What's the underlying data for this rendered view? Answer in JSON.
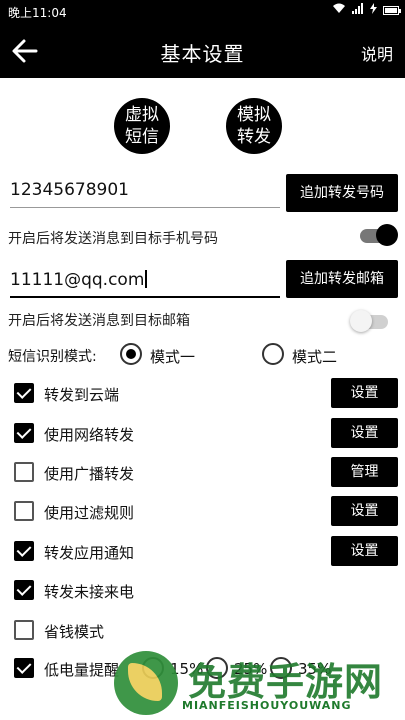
{
  "status_bar": {
    "time": "晚上11:04",
    "wifi_icon": "wifi-icon",
    "signal_icon": "signal-icon",
    "bolt_icon": "charging-icon",
    "battery_level": 0.85
  },
  "app_bar": {
    "back_icon": "arrow-left-icon",
    "title": "基本设置",
    "help": "说明"
  },
  "circle_buttons": {
    "virtual_sms": [
      "虚拟",
      "短信"
    ],
    "simulate_forward": [
      "模拟",
      "转发"
    ]
  },
  "phone": {
    "value": "12345678901",
    "add_button": "追加转发号码",
    "description": "开启后将发送消息到目标手机号码",
    "toggle_on": true
  },
  "email": {
    "value": "11111@qq.com",
    "add_button": "追加转发邮箱",
    "description": "开启后将发送消息到目标邮箱",
    "toggle_on": false
  },
  "sms_mode": {
    "label": "短信识别模式:",
    "option1": "模式一",
    "option2": "模式二",
    "selected": "模式一"
  },
  "options": [
    {
      "label": "转发到云端",
      "checked": true,
      "button": "设置"
    },
    {
      "label": "使用网络转发",
      "checked": true,
      "button": "设置"
    },
    {
      "label": "使用广播转发",
      "checked": false,
      "button": "管理"
    },
    {
      "label": "使用过滤规则",
      "checked": false,
      "button": "设置"
    },
    {
      "label": "转发应用通知",
      "checked": true,
      "button": "设置"
    },
    {
      "label": "转发未接来电",
      "checked": true,
      "button": ""
    },
    {
      "label": "省钱模式",
      "checked": false,
      "button": ""
    },
    {
      "label": "低电量提醒",
      "checked": true,
      "button": ""
    }
  ],
  "battery_levels": [
    "15%",
    "25%",
    "35%"
  ],
  "watermark": {
    "text": "免费手游网",
    "sub": "MIANFEISHOUYOUWANG"
  }
}
